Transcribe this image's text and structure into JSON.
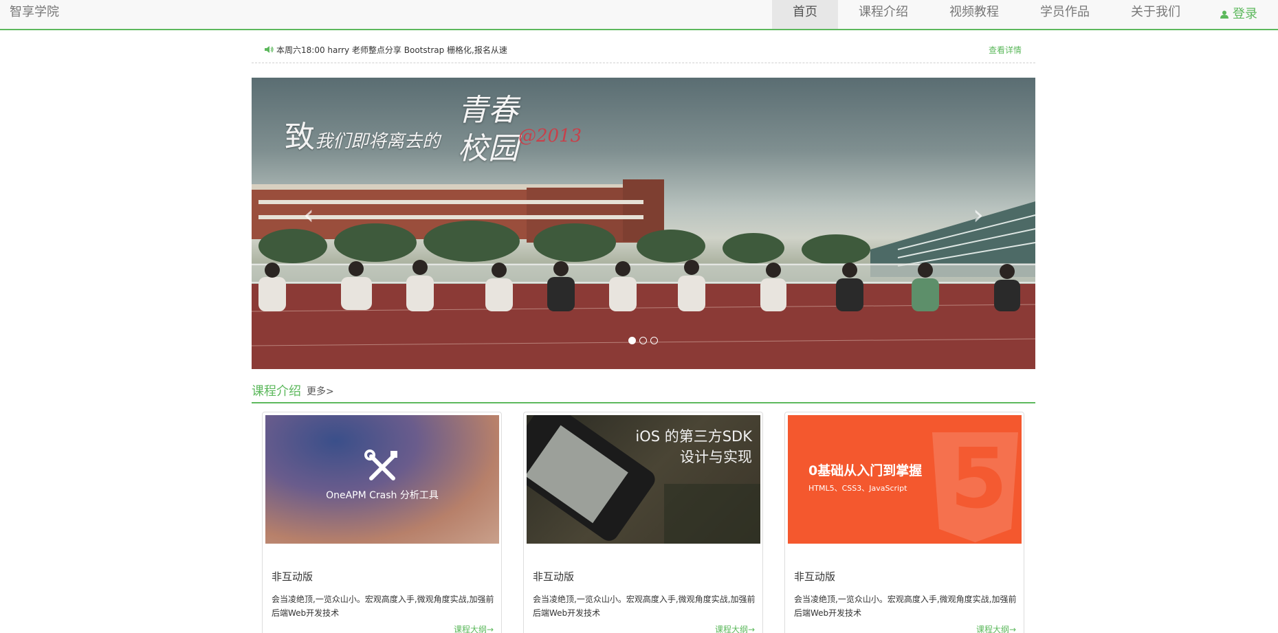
{
  "navbar": {
    "brand": "智享学院",
    "items": [
      {
        "label": "首页",
        "active": true
      },
      {
        "label": "课程介绍"
      },
      {
        "label": "视频教程"
      },
      {
        "label": "学员作品"
      },
      {
        "label": "关于我们"
      }
    ],
    "login_label": "登录",
    "accent": "#5cb85c"
  },
  "notice": {
    "icon": "speaker-icon",
    "text": "本周六18:00 harry 老师整点分享 Bootstrap 栅格化,报名从速",
    "more_label": "查看详情"
  },
  "carousel": {
    "caption_line1_big": "致",
    "caption_line1": "我们即将离去的",
    "caption_title": "青春",
    "caption_title2": "校园",
    "caption_year": "@2013",
    "prev_icon": "chevron-left-icon",
    "next_icon": "chevron-right-icon",
    "indicator_count": 3,
    "active_index": 0
  },
  "courses_section": {
    "title": "课程介绍",
    "more_label": "更多>"
  },
  "courses": [
    {
      "image_text": "OneAPM Crash 分析工具",
      "image_icon": "tools-icon",
      "title": "非互动版",
      "desc": "会当凌绝顶,一览众山小。宏观高度入手,微观角度实战,加强前后端Web开发技术",
      "link": "课程大纲→"
    },
    {
      "image_text_1": "iOS 的第三方SDK",
      "image_text_2": "设计与实现",
      "title": "非互动版",
      "desc": "会当凌绝顶,一览众山小。宏观高度入手,微观角度实战,加强前后端Web开发技术",
      "link": "课程大纲→"
    },
    {
      "image_text_1": "0基础从入门到掌握",
      "image_text_2": "HTML5、CSS3、JavaScript",
      "image_badge": "5",
      "title": "非互动版",
      "desc": "会当凌绝顶,一览众山小。宏观高度入手,微观角度实战,加强前后端Web开发技术",
      "link": "课程大纲→"
    }
  ]
}
